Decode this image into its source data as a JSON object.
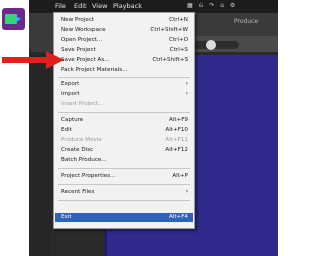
{
  "menubar": {
    "items": [
      "File",
      "Edit",
      "View",
      "Playback"
    ],
    "produce_label": "Produce"
  },
  "file_menu": {
    "items": [
      {
        "label": "New Project",
        "shortcut": "Ctrl+N"
      },
      {
        "label": "New Workspace",
        "shortcut": "Ctrl+Shift+W"
      },
      {
        "label": "Open Project...",
        "shortcut": "Ctrl+O"
      },
      {
        "label": "Save Project",
        "shortcut": "Ctrl+S"
      },
      {
        "label": "Save Project As...",
        "shortcut": "Ctrl+Shift+S"
      },
      {
        "label": "Pack Project Materials...",
        "shortcut": ""
      },
      {
        "label": "Export",
        "shortcut": ""
      },
      {
        "label": "Import",
        "shortcut": ""
      },
      {
        "label": "Insert Project...",
        "shortcut": ""
      },
      {
        "label": "Capture",
        "shortcut": "Alt+F9"
      },
      {
        "label": "Edit",
        "shortcut": "Alt+F10"
      },
      {
        "label": "Produce Movie",
        "shortcut": "Alt+F11"
      },
      {
        "label": "Create Disc",
        "shortcut": "Alt+F12"
      },
      {
        "label": "Batch Produce...",
        "shortcut": ""
      },
      {
        "label": "Project Properties...",
        "shortcut": "Alt+P"
      },
      {
        "label": "Recent Files",
        "shortcut": ""
      },
      {
        "label": "Exit",
        "shortcut": "Alt+F4"
      }
    ],
    "highlighted": "Exit",
    "pointed_item": "Save Project"
  },
  "colors": {
    "arrow": "#e0201c",
    "highlight": "#2f63b7",
    "preview": "#2f2a8c"
  }
}
